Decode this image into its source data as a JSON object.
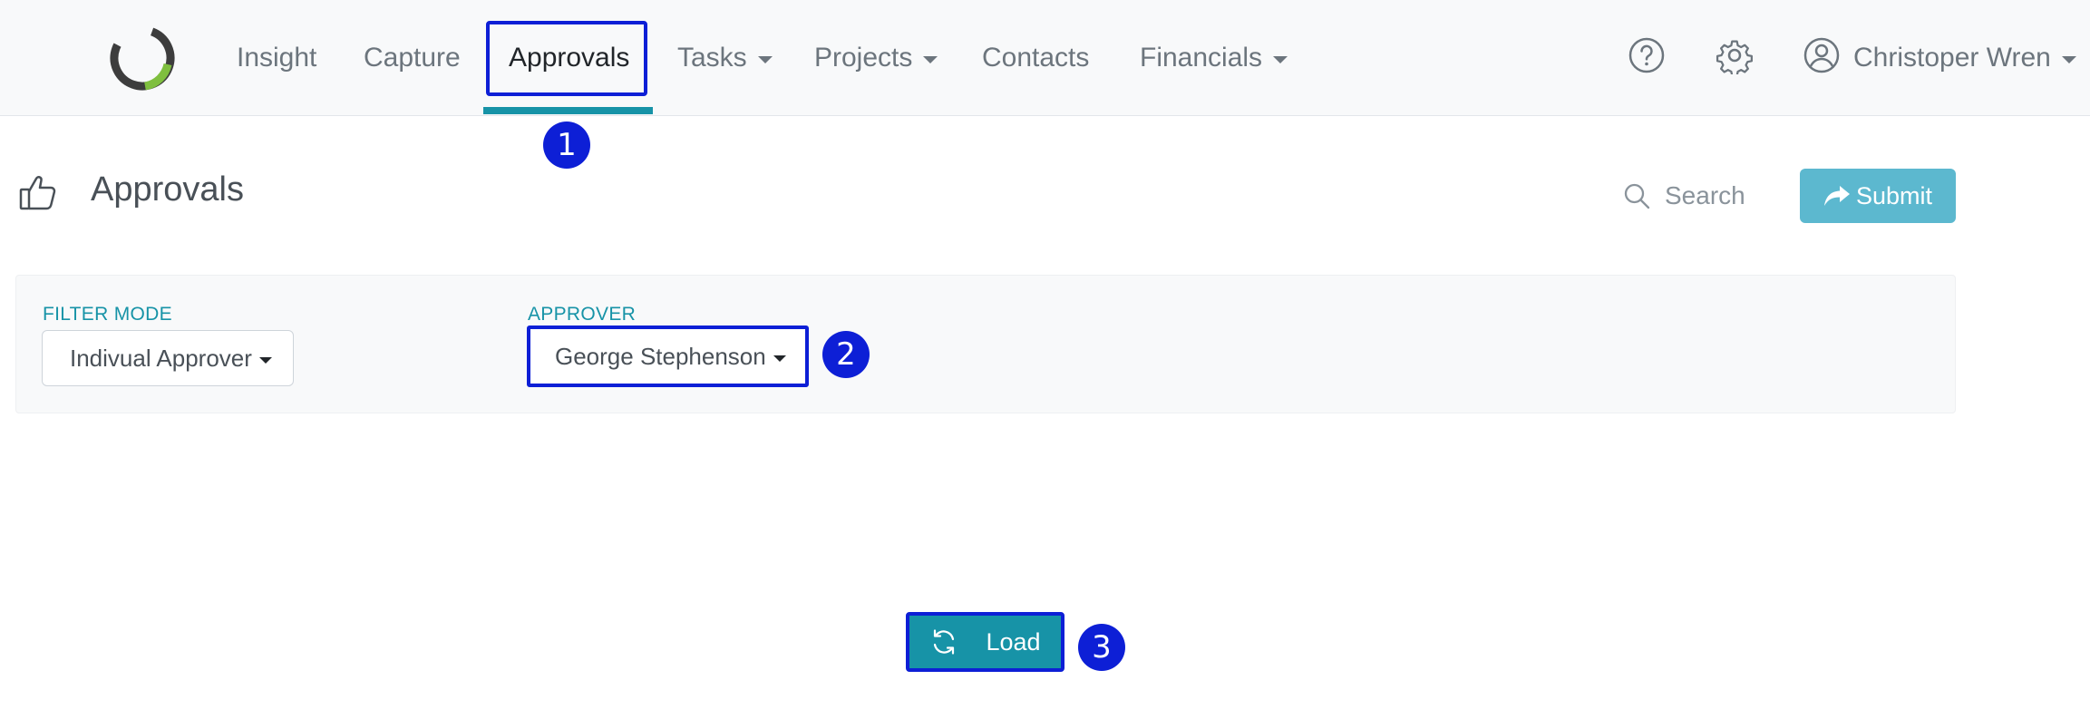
{
  "colors": {
    "accent": "#1793a7",
    "highlight": "#0d1fd6",
    "submit": "#5cb8cf",
    "logo_dark": "#3d3d3d",
    "logo_green": "#7fbf3f"
  },
  "navbar": {
    "logo_icon": "ring-logo-icon",
    "items": [
      {
        "label": "Insight",
        "dropdown": false,
        "active": false
      },
      {
        "label": "Capture",
        "dropdown": false,
        "active": false
      },
      {
        "label": "Approvals",
        "dropdown": false,
        "active": true
      },
      {
        "label": "Tasks",
        "dropdown": true,
        "active": false
      },
      {
        "label": "Projects",
        "dropdown": true,
        "active": false
      },
      {
        "label": "Contacts",
        "dropdown": false,
        "active": false
      },
      {
        "label": "Financials",
        "dropdown": true,
        "active": false
      }
    ],
    "help_icon": "help-circle-icon",
    "settings_icon": "gear-icon",
    "user": {
      "icon": "user-circle-icon",
      "name": "Christoper Wren"
    }
  },
  "markers": [
    "1",
    "2",
    "3"
  ],
  "page": {
    "icon": "thumbs-up-icon",
    "title": "Approvals",
    "search": {
      "icon": "search-icon",
      "placeholder": "Search"
    },
    "submit": {
      "icon": "share-arrow-icon",
      "label": "Submit"
    }
  },
  "filters": {
    "filter_mode": {
      "label": "FILTER MODE",
      "value": "Indivual Approver"
    },
    "approver": {
      "label": "APPROVER",
      "value": "George Stephenson"
    }
  },
  "load": {
    "icon": "refresh-icon",
    "label": "Load"
  }
}
